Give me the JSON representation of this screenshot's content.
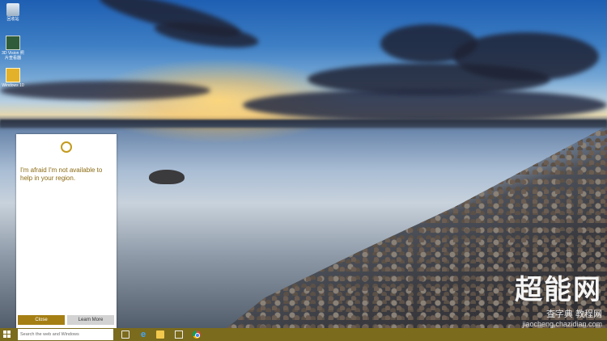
{
  "desktop": {
    "icons": [
      {
        "label": "回收站",
        "icon": "recycle-bin-icon"
      },
      {
        "label": "3D Vision 照片查看器",
        "icon": "3d-vision-photo-viewer-icon"
      },
      {
        "label": "Windows 10",
        "icon": "app-shortcut-icon"
      }
    ]
  },
  "cortana": {
    "message": "I'm afraid I'm not available to help in your region.",
    "close_label": "Close",
    "learn_more_label": "Learn More"
  },
  "taskbar": {
    "search_placeholder": "Search the web and Windows",
    "pinned": [
      "task-view-icon",
      "edge-icon",
      "file-explorer-icon",
      "store-icon",
      "chrome-icon"
    ]
  },
  "watermark": {
    "logo": "超能网",
    "sub": "查字典 教程网",
    "url": "jiaocheng.chazidian.com"
  },
  "colors": {
    "accent": "#a57f14",
    "taskbar": "#7b6b1d",
    "message_text": "#8a6a10"
  }
}
